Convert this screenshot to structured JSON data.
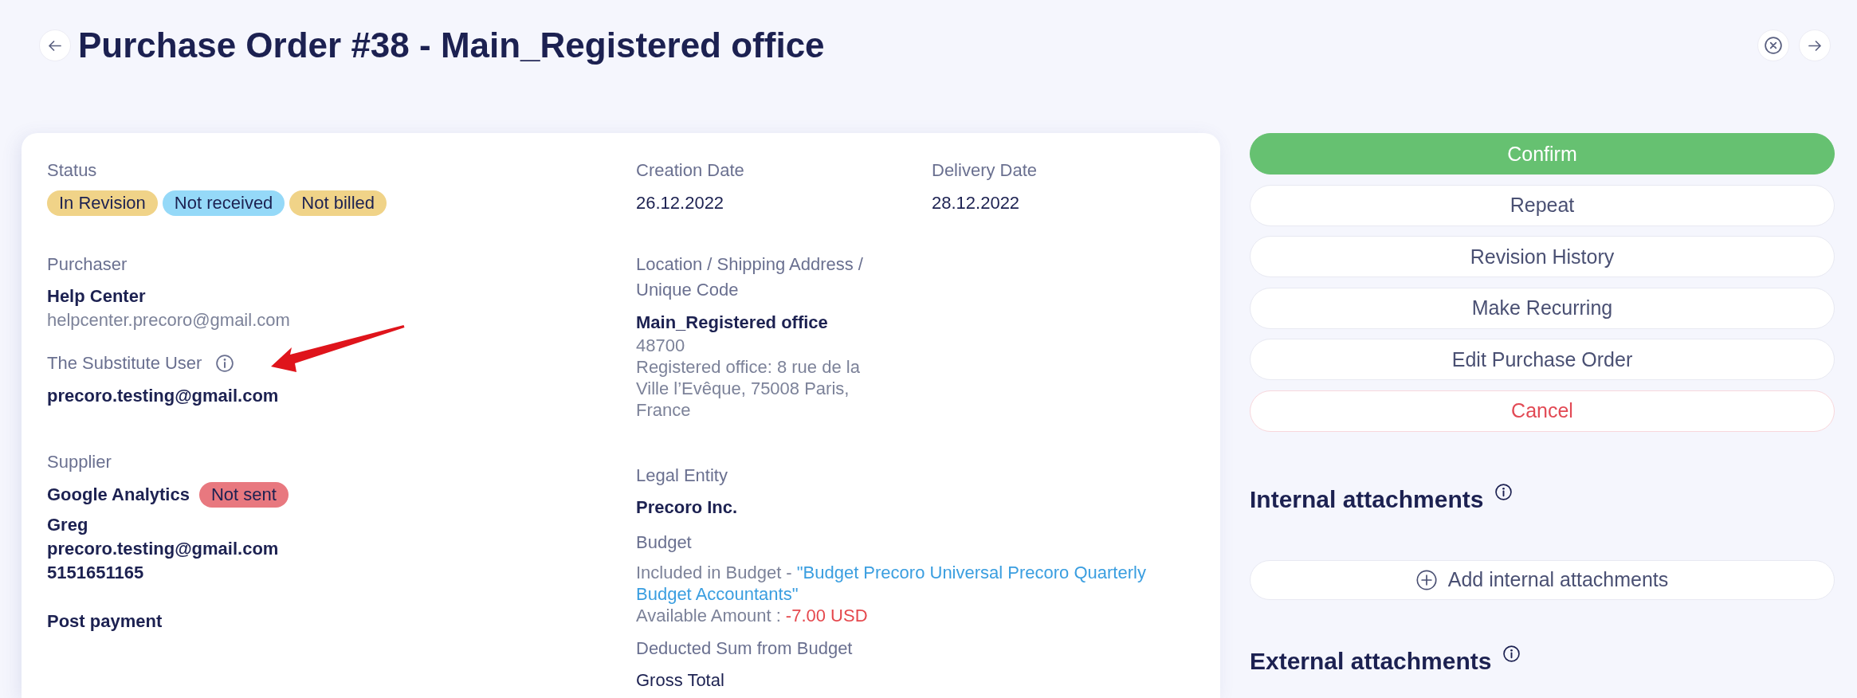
{
  "header": {
    "title": "Purchase Order #38 - Main_Registered office"
  },
  "details": {
    "status": {
      "label": "Status",
      "badges": [
        {
          "label": "In Revision",
          "color": "#f0d388"
        },
        {
          "label": "Not received",
          "color": "#95d9f8"
        },
        {
          "label": "Not billed",
          "color": "#f0d388"
        }
      ]
    },
    "purchaser": {
      "label": "Purchaser",
      "name": "Help Center",
      "email": "helpcenter.precoro@gmail.com"
    },
    "substitute_user": {
      "label": "The Substitute User",
      "value": "precoro.testing@gmail.com"
    },
    "supplier": {
      "label": "Supplier",
      "name": "Google Analytics",
      "badge": {
        "label": "Not sent",
        "color": "#e8787f"
      },
      "contact": "Greg",
      "email": "precoro.testing@gmail.com",
      "phone": "5151651165",
      "payment_terms": "Post payment"
    },
    "creation_date": {
      "label": "Creation Date",
      "value": "26.12.2022"
    },
    "delivery_date": {
      "label": "Delivery Date",
      "value": "28.12.2022"
    },
    "location": {
      "label": "Location / Shipping Address / Unique Code",
      "name": "Main_Registered office",
      "code": "48700",
      "address": "Registered office: 8 rue de la Ville l’Evêque, 75008 Paris, France"
    },
    "legal_entity": {
      "label": "Legal Entity",
      "value": "Precoro Inc."
    },
    "budget": {
      "label": "Budget",
      "included_prefix": "Included in Budget -",
      "budget_link_lines": [
        "\"Budget Precoro Universal Precoro Quarterly",
        "Budget Accountants\""
      ],
      "available_label": "Available Amount :",
      "available_value": "-7.00 USD"
    },
    "deducted": {
      "label": "Deducted Sum from Budget",
      "value": "Gross Total"
    }
  },
  "actions": [
    {
      "label": "Confirm",
      "kind": "primary"
    },
    {
      "label": "Repeat",
      "kind": "default"
    },
    {
      "label": "Revision History",
      "kind": "default"
    },
    {
      "label": "Make Recurring",
      "kind": "default"
    },
    {
      "label": "Edit Purchase Order",
      "kind": "default"
    },
    {
      "label": "Cancel",
      "kind": "danger"
    }
  ],
  "attachments": [
    {
      "title": "Internal attachments",
      "add_button": "Add internal attachments"
    },
    {
      "title": "External attachments"
    }
  ]
}
